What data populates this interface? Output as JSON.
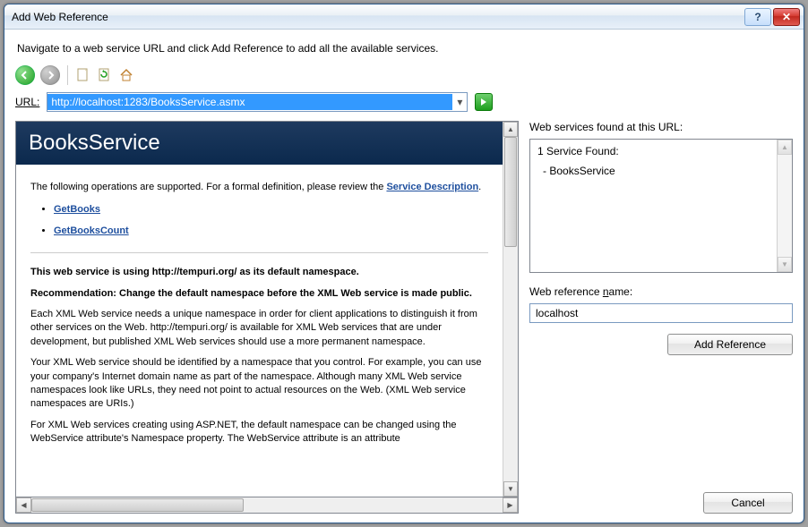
{
  "window": {
    "title": "Add Web Reference"
  },
  "instruction": "Navigate to a web service URL and click Add Reference to add all the available services.",
  "url": {
    "label": "URL:",
    "value": "http://localhost:1283/BooksService.asmx"
  },
  "preview": {
    "service_title": "BooksService",
    "intro_prefix": "The following operations are supported. For a formal definition, please review the ",
    "service_desc_link": "Service Description",
    "intro_suffix": ".",
    "operations": [
      "GetBooks",
      "GetBooksCount"
    ],
    "ns_heading": "This web service is using http://tempuri.org/ as its default namespace.",
    "ns_reco": "Recommendation: Change the default namespace before the XML Web service is made public.",
    "ns_para1": "Each XML Web service needs a unique namespace in order for client applications to distinguish it from other services on the Web. http://tempuri.org/ is available for XML Web services that are under development, but published XML Web services should use a more permanent namespace.",
    "ns_para2": "Your XML Web service should be identified by a namespace that you control. For example, you can use your company's Internet domain name as part of the namespace. Although many XML Web service namespaces look like URLs, they need not point to actual resources on the Web. (XML Web service namespaces are URIs.)",
    "ns_para3": "For XML Web services creating using ASP.NET, the default namespace can be changed using the WebService attribute's Namespace property. The WebService attribute is an attribute"
  },
  "right": {
    "found_label": "Web services found at this URL:",
    "found_count_text": "1 Service Found:",
    "services": [
      "BooksService"
    ],
    "ref_name_label_prefix": "Web reference ",
    "ref_name_label_underlined": "n",
    "ref_name_label_suffix": "ame:",
    "ref_name_value": "localhost",
    "add_btn": "Add Reference"
  },
  "footer": {
    "cancel": "Cancel"
  },
  "titlebar": {
    "help": "?",
    "close": "✕"
  }
}
